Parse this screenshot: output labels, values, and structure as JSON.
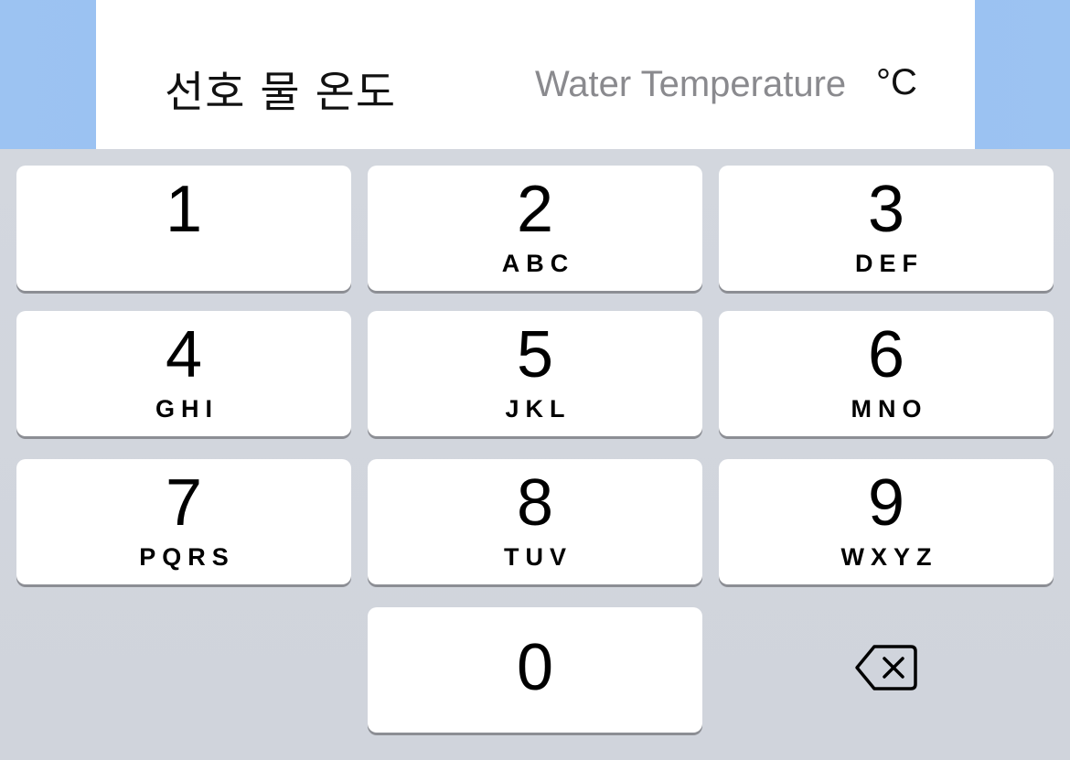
{
  "form": {
    "label": "선호 물 온도",
    "input_placeholder": "Water Temperature",
    "input_value": "",
    "unit": "°C"
  },
  "keypad": {
    "keys": [
      {
        "digit": "1",
        "letters": ""
      },
      {
        "digit": "2",
        "letters": "ABC"
      },
      {
        "digit": "3",
        "letters": "DEF"
      },
      {
        "digit": "4",
        "letters": "GHI"
      },
      {
        "digit": "5",
        "letters": "JKL"
      },
      {
        "digit": "6",
        "letters": "MNO"
      },
      {
        "digit": "7",
        "letters": "PQRS"
      },
      {
        "digit": "8",
        "letters": "TUV"
      },
      {
        "digit": "9",
        "letters": "WXYZ"
      },
      {
        "digit": "0",
        "letters": ""
      }
    ],
    "delete_icon": "delete-backspace-icon"
  },
  "colors": {
    "header_background": "#97bff1",
    "card_background": "#ffffff",
    "keyboard_background": "#d1d5db",
    "key_background": "#ffffff",
    "placeholder_text": "#8a8a8e"
  }
}
